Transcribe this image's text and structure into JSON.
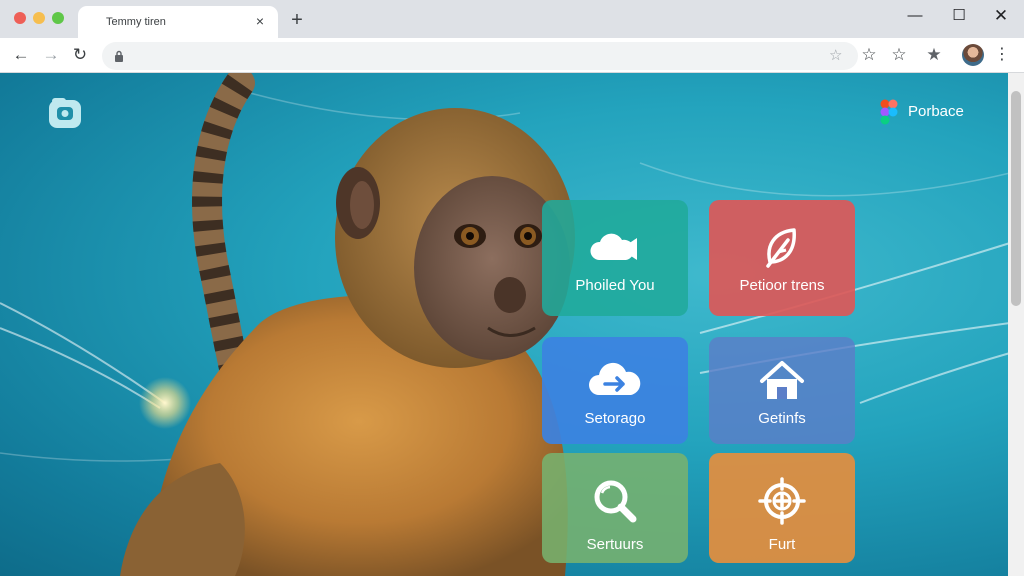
{
  "browser": {
    "tab_title": "Temmy tiren",
    "tab_close": "×",
    "new_tab": "+",
    "window_controls": {
      "minimize": "—",
      "maximize": "☐",
      "close": "✕"
    },
    "nav": {
      "back": "←",
      "forward": "→",
      "reload": "↻"
    },
    "omnibox_star": "☆",
    "toolbar_icons": [
      "☆",
      "☆",
      "★"
    ],
    "menu": "⋮"
  },
  "page": {
    "brand_label": "Porbace",
    "tiles": [
      {
        "label": "Phoiled You",
        "icon": "cloud-video-icon"
      },
      {
        "label": "Petioor trens",
        "icon": "leaf-pen-icon"
      },
      {
        "label": "Setorago",
        "icon": "cloud-upload-icon"
      },
      {
        "label": "Getinfs",
        "icon": "house-icon"
      },
      {
        "label": "Sertuurs",
        "icon": "magnifier-icon"
      },
      {
        "label": "Furt",
        "icon": "crosshair-icon"
      }
    ]
  },
  "colors": {
    "tabstrip": "#dee1e6",
    "background_teal": "#23a3bd",
    "tile_teal": "#20aa9b",
    "tile_red": "#dc5858",
    "tile_blue": "#3c82e1",
    "tile_slate": "#5c7ec8",
    "tile_green": "#78b26e",
    "tile_orange": "#e48e3e"
  }
}
